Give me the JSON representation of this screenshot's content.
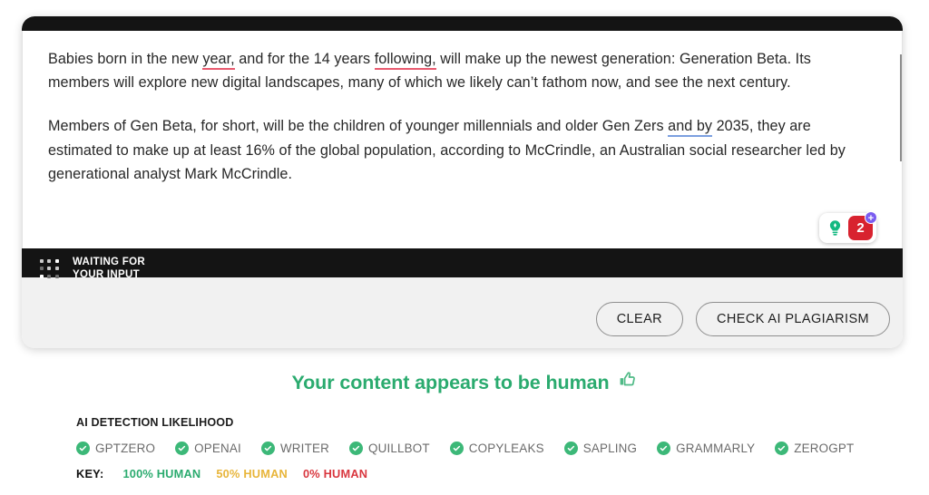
{
  "editor": {
    "paragraphs": [
      {
        "segments": [
          {
            "text": "Babies born in the new ",
            "style": "plain"
          },
          {
            "text": "year,",
            "style": "underline-red"
          },
          {
            "text": " and for the 14 years ",
            "style": "plain"
          },
          {
            "text": "following,",
            "style": "underline-red"
          },
          {
            "text": " will make up the newest generation: Generation Beta. Its members will explore new digital landscapes, many of which we likely can’t fathom now, and see the next century.",
            "style": "plain"
          }
        ]
      },
      {
        "segments": [
          {
            "text": "Members of Gen Beta, for short, will be the children of younger millennials and older Gen Zers ",
            "style": "plain"
          },
          {
            "text": "and by",
            "style": "underline-blue"
          },
          {
            "text": " 2035, they are estimated to make up at least 16% of the global population, according to McCrindle, an Australian social researcher led by generational analyst Mark McCrindle.",
            "style": "plain"
          }
        ]
      }
    ],
    "suggestion_pill": {
      "bulb_icon": "lightbulb-icon",
      "count": "2",
      "plus": "+"
    }
  },
  "status": {
    "icon": "dot-grid-loading-icon",
    "line1": "WAITING FOR",
    "line2": "YOUR INPUT"
  },
  "footer": {
    "clear_label": "CLEAR",
    "check_label": "CHECK AI PLAGIARISM"
  },
  "results": {
    "verdict": "Your content appears to be human",
    "verdict_icon": "thumbs-up-icon",
    "likelihood_label": "AI DETECTION LIKELIHOOD",
    "detectors": [
      {
        "name": "GPTZERO",
        "status_icon": "check-circle-icon"
      },
      {
        "name": "OPENAI",
        "status_icon": "check-circle-icon"
      },
      {
        "name": "WRITER",
        "status_icon": "check-circle-icon"
      },
      {
        "name": "QUILLBOT",
        "status_icon": "check-circle-icon"
      },
      {
        "name": "COPYLEAKS",
        "status_icon": "check-circle-icon"
      },
      {
        "name": "SAPLING",
        "status_icon": "check-circle-icon"
      },
      {
        "name": "GRAMMARLY",
        "status_icon": "check-circle-icon"
      },
      {
        "name": "ZEROGPT",
        "status_icon": "check-circle-icon"
      }
    ],
    "key": {
      "label": "KEY:",
      "items": [
        {
          "text": "100% HUMAN",
          "color": "#2bab6f"
        },
        {
          "text": "50% HUMAN",
          "color": "#e8b53a"
        },
        {
          "text": "0% HUMAN",
          "color": "#d9373f"
        }
      ]
    }
  },
  "colors": {
    "accent_green": "#2bab6f",
    "check_green": "#3cb878",
    "warning_amber": "#e8b53a",
    "danger_red": "#d9373f",
    "dark_bar": "#141414",
    "footer_gray": "#f1f1f1",
    "underline_red": "#e8596e",
    "underline_blue": "#7b9fe0"
  }
}
